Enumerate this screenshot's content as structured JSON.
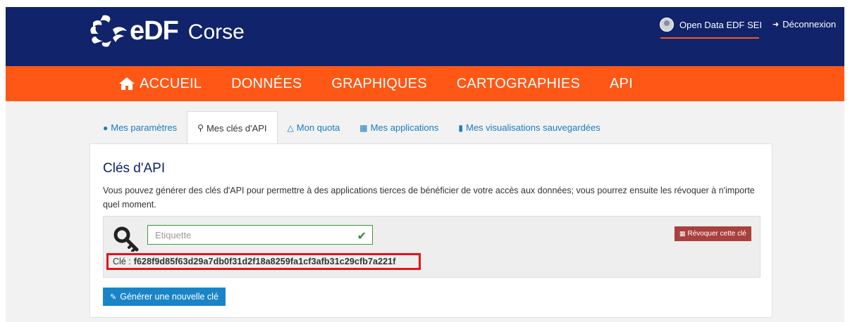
{
  "brand": {
    "logo_text": "eDF",
    "subtitle": "Corse",
    "colors": {
      "navy": "#10236b",
      "orange": "#fe5716",
      "link": "#1a7bbf"
    }
  },
  "header": {
    "user_name": "Open Data EDF SEI",
    "logout_label": "Déconnexion"
  },
  "nav": {
    "items": [
      {
        "label": "ACCUEIL",
        "icon": "home-icon"
      },
      {
        "label": "DONNÉES"
      },
      {
        "label": "GRAPHIQUES"
      },
      {
        "label": "CARTOGRAPHIES"
      },
      {
        "label": "API"
      }
    ]
  },
  "tabs": [
    {
      "label": "Mes paramètres",
      "icon": "user-icon",
      "active": false
    },
    {
      "label": "Mes clés d'API",
      "icon": "key-icon",
      "active": true
    },
    {
      "label": "Mon quota",
      "icon": "flask-icon",
      "active": false
    },
    {
      "label": "Mes applications",
      "icon": "puzzle-icon",
      "active": false
    },
    {
      "label": "Mes visualisations sauvegardées",
      "icon": "bookmark-icon",
      "active": false
    }
  ],
  "panel": {
    "title": "Clés d'API",
    "description": "Vous pouvez générer des clés d'API pour permettre à des applications tierces de bénéficier de votre accès aux données; vous pourrez ensuite les révoquer à n'importe quel moment.",
    "key_entry": {
      "label_placeholder": "Etiquette",
      "revoke_label": "Révoquer cette clé",
      "key_prefix": "Clé :",
      "key_value": "f628f9d85f63d29a7db0f31d2f18a8259fa1cf3afb31c29cfb7a221f"
    },
    "generate_label": "Générer une nouvelle clé"
  }
}
